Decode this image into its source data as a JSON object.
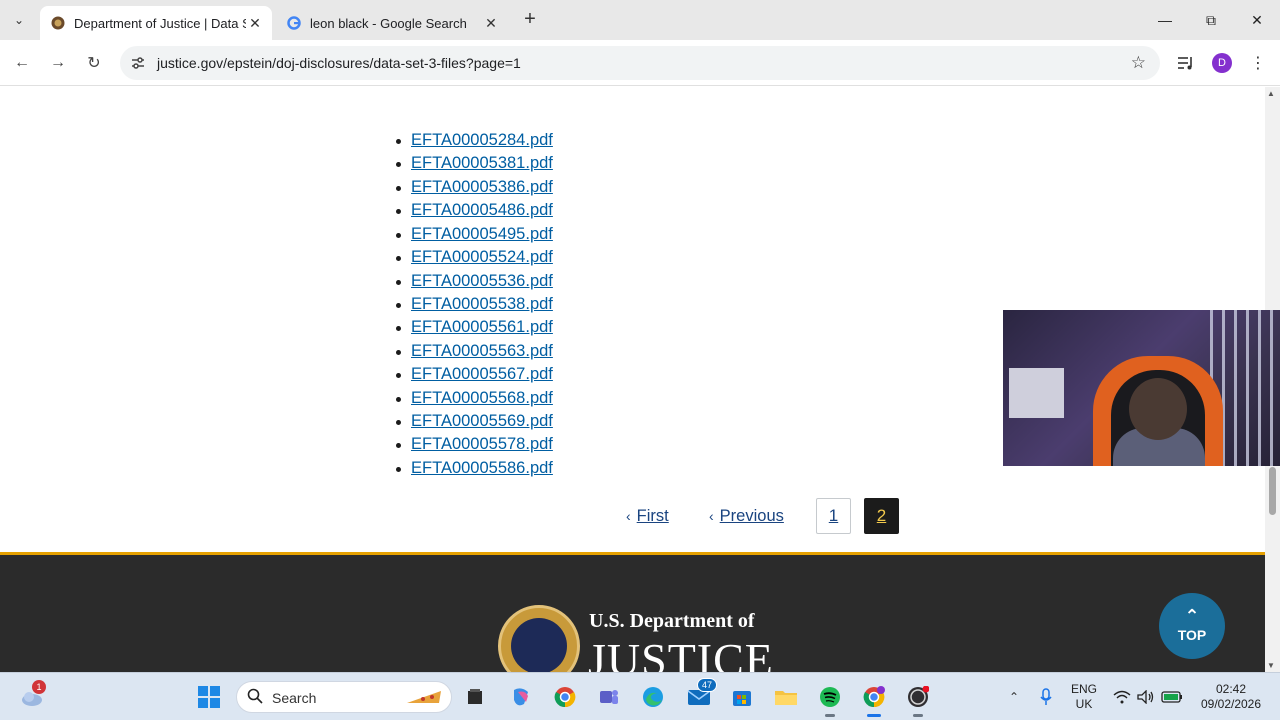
{
  "browser": {
    "tabs": [
      {
        "title": "Department of Justice | Data Se",
        "favicon": "doj-seal-icon",
        "active": true
      },
      {
        "title": "leon black - Google Search",
        "favicon": "google-icon",
        "active": false
      }
    ],
    "url": "justice.gov/epstein/doj-disclosures/data-set-3-files?page=1",
    "profile_initial": "D"
  },
  "files": [
    "EFTA00005284.pdf",
    "EFTA00005381.pdf",
    "EFTA00005386.pdf",
    "EFTA00005486.pdf",
    "EFTA00005495.pdf",
    "EFTA00005524.pdf",
    "EFTA00005536.pdf",
    "EFTA00005538.pdf",
    "EFTA00005561.pdf",
    "EFTA00005563.pdf",
    "EFTA00005567.pdf",
    "EFTA00005568.pdf",
    "EFTA00005569.pdf",
    "EFTA00005578.pdf",
    "EFTA00005586.pdf"
  ],
  "pagination": {
    "first_label": "First",
    "previous_label": "Previous",
    "pages": [
      "1",
      "2"
    ],
    "current": "2"
  },
  "footer": {
    "line1": "U.S. Department of",
    "line2": "JUSTICE",
    "top_label": "TOP"
  },
  "taskbar": {
    "search_label": "Search",
    "weather_badge": "1",
    "mail_badge": "47",
    "lang_line1": "ENG",
    "lang_line2": "UK",
    "time": "02:42",
    "date": "09/02/2026"
  },
  "colors": {
    "link": "#005ea2",
    "footer_bg": "#2b2b2b",
    "footer_accent": "#e5a000",
    "top_button": "#1b6e9a"
  }
}
